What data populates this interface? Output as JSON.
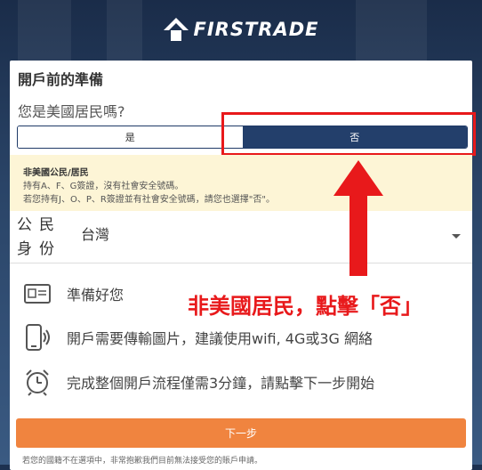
{
  "header": {
    "brand": "FIRSTRADE"
  },
  "section": {
    "title": "開戶前的準備",
    "question": "您是美國居民嗎?",
    "options": {
      "yes": "是",
      "no": "否",
      "selected": "no"
    }
  },
  "note": {
    "title": "非美國公民/居民",
    "line1": "持有A、F、G簽證，沒有社會安全號碼。",
    "line2": "若您持有J、O、P、R簽證並有社會安全號碼，請您也選擇\"否\"。"
  },
  "citizenship": {
    "label": "公民身份",
    "value": "台灣"
  },
  "prep": [
    {
      "icon": "id-card-icon",
      "text": "準備好您"
    },
    {
      "icon": "mobile-signal-icon",
      "text": "開戶需要傳輸圖片，建議使用wifi, 4G或3G 網絡"
    },
    {
      "icon": "alarm-clock-icon",
      "text": "完成整個開戶流程僅需3分鐘，請點擊下一步開始"
    }
  ],
  "annotation": {
    "text": "非美國居民，點擊「否」",
    "color": "#e8191b"
  },
  "next_button": "下一步",
  "footer": "若您的國籍不在選項中，非常抱歉我們目前無法接受您的賬戶申請。",
  "colors": {
    "primary": "#233f6b",
    "accent": "#f0843f",
    "note_bg": "#fdf5d6"
  }
}
